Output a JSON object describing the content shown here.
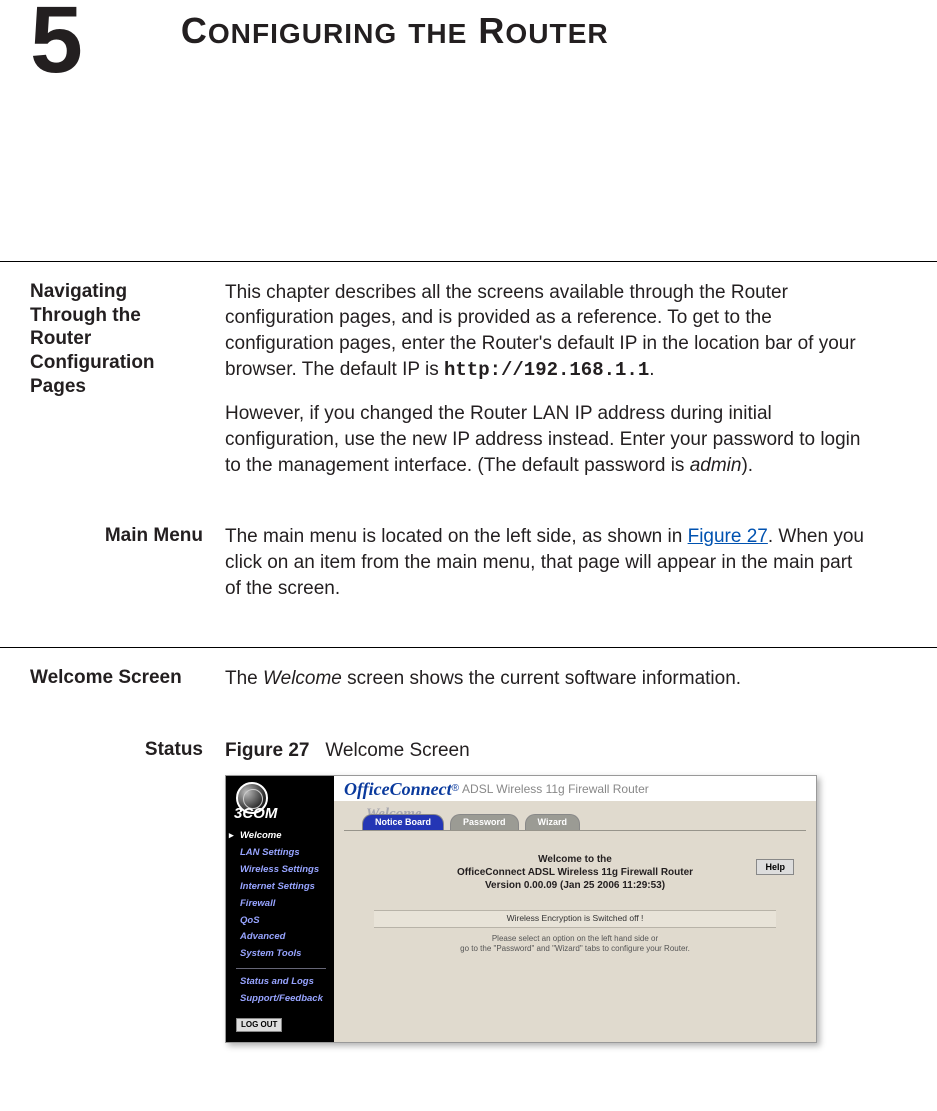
{
  "chapter": {
    "number": "5",
    "title_html": "C<span style='font-size:0.78em'>ONFIGURING</span> <span style='font-size:0.78em'>THE</span> R<span style='font-size:0.78em'>OUTER</span>"
  },
  "sections": {
    "nav": {
      "heading": "Navigating Through the Router Configuration Pages",
      "para1_prefix": "This chapter describes all the screens available through the Router configuration pages, and is provided as a reference. To get to the configuration pages, enter the Router's default IP in the location bar of your browser. The default IP is ",
      "default_ip": "http://192.168.1.1",
      "para1_suffix": ".",
      "para2_prefix": "However, if you changed the Router LAN IP address during initial configuration, use the new IP address instead. Enter your password to login to the management interface. (The default password is ",
      "default_pw": "admin",
      "para2_suffix": ")."
    },
    "mainmenu": {
      "heading": "Main Menu",
      "text_prefix": "The main menu is located on the left side, as shown in ",
      "figlink": "Figure 27",
      "text_suffix": ". When you click on an item from the main menu, that page will appear in the main part of the screen."
    },
    "welcome": {
      "heading": "Welcome Screen",
      "text_prefix": "The ",
      "text_ital": "Welcome",
      "text_suffix": " screen shows the current software information."
    },
    "status": {
      "heading": "Status",
      "figlabel_num": "Figure 27",
      "figlabel_cap": "Welcome Screen"
    }
  },
  "figure": {
    "brand_logo_text": "3COM",
    "brand_name": "OfficeConnect",
    "brand_reg": "®",
    "brand_sub": "ADSL Wireless 11g Firewall Router",
    "page_title": "Welcome",
    "tabs": [
      "Notice Board",
      "Password",
      "Wizard"
    ],
    "selected_tab": 0,
    "sidebar": {
      "items": [
        "Welcome",
        "LAN Settings",
        "Wireless Settings",
        "Internet Settings",
        "Firewall",
        "QoS",
        "Advanced",
        "System Tools"
      ],
      "items2": [
        "Status and Logs",
        "Support/Feedback"
      ],
      "selected": 0,
      "logout": "LOG OUT"
    },
    "welcome_line1": "Welcome to the",
    "welcome_line2": "OfficeConnect ADSL Wireless 11g Firewall Router",
    "welcome_line3": "Version 0.00.09 (Jan 25 2006 11:29:53)",
    "help": "Help",
    "warn": "Wireless Encryption is Switched off !",
    "hint_line1": "Please select an option on the left hand side or",
    "hint_line2": "go to the \"Password\" and \"Wizard\" tabs to configure your Router."
  }
}
